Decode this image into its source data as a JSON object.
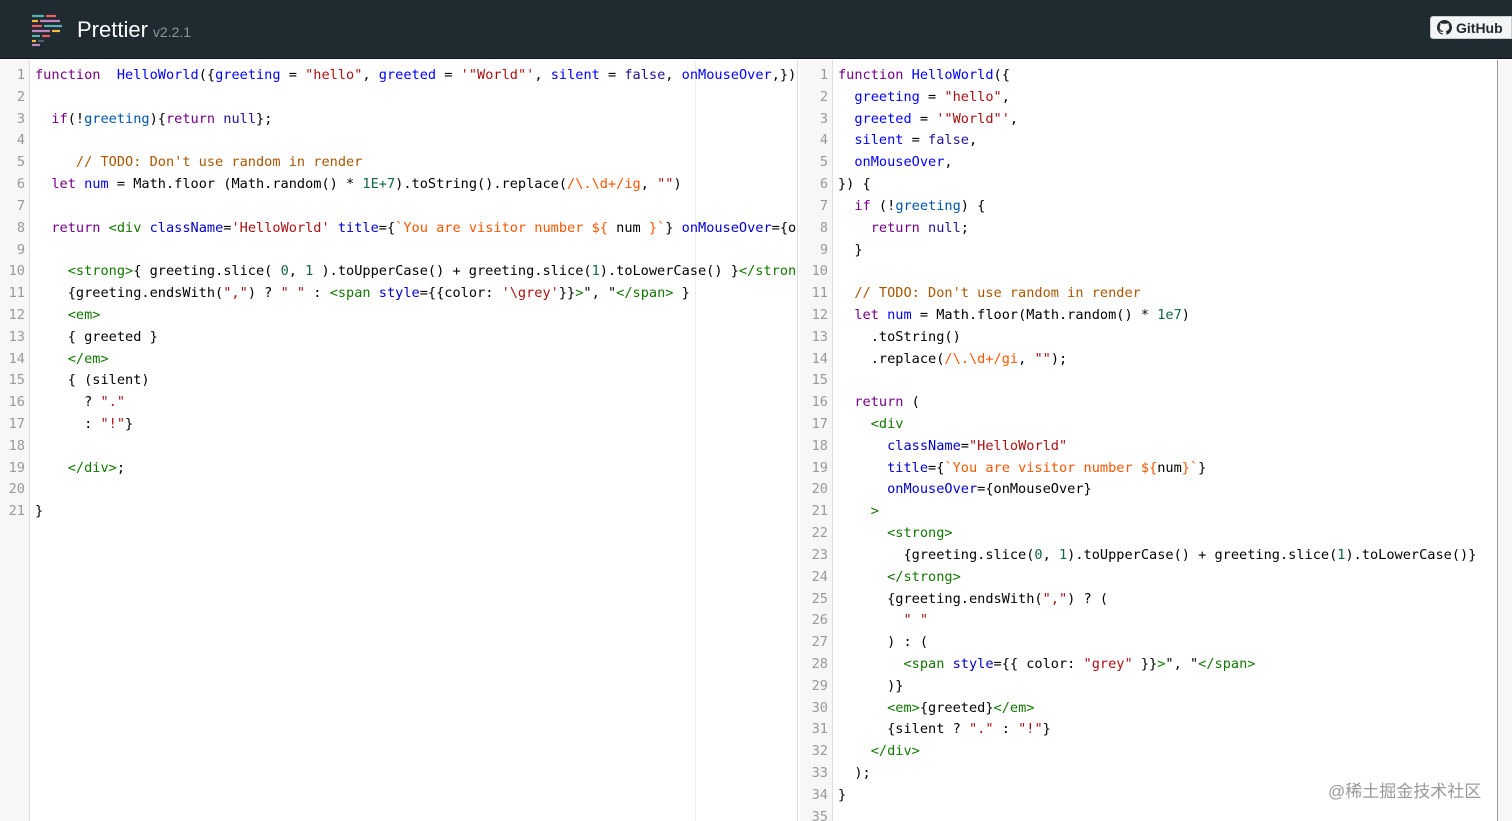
{
  "header": {
    "title": "Prettier",
    "version": "v2.2.1",
    "github_label": "GitHub"
  },
  "colors": {
    "header_bg": "#1f2a31",
    "keyword": "#770088",
    "def": "#0000ff",
    "string": "#aa1111",
    "comment": "#aa5500",
    "tag": "#117700"
  },
  "watermark": "@稀土掘金技术社区",
  "input_lines": [
    [
      [
        "kw",
        "function"
      ],
      [
        "",
        "  "
      ],
      [
        "def",
        "HelloWorld"
      ],
      [
        "",
        "({"
      ],
      [
        "def",
        "greeting"
      ],
      [
        "",
        " = "
      ],
      [
        "str",
        "\"hello\""
      ],
      [
        "",
        ", "
      ],
      [
        "def",
        "greeted"
      ],
      [
        "",
        " = "
      ],
      [
        "str",
        "'\"World\"'"
      ],
      [
        "",
        ", "
      ],
      [
        "def",
        "silent"
      ],
      [
        "",
        " = "
      ],
      [
        "atom",
        "false"
      ],
      [
        "",
        ", "
      ],
      [
        "def",
        "onMouseOver"
      ],
      [
        "",
        ",})"
      ]
    ],
    [],
    [
      [
        "",
        "  "
      ],
      [
        "kw",
        "if"
      ],
      [
        "",
        "(!"
      ],
      [
        "v2",
        "greeting"
      ],
      [
        "",
        "){"
      ],
      [
        "kw",
        "return"
      ],
      [
        "",
        " "
      ],
      [
        "atom",
        "null"
      ],
      [
        "",
        "};"
      ]
    ],
    [],
    [
      [
        "",
        "     "
      ],
      [
        "cm",
        "// TODO: Don't use random in render"
      ]
    ],
    [
      [
        "",
        "  "
      ],
      [
        "kw",
        "let"
      ],
      [
        "",
        " "
      ],
      [
        "def",
        "num"
      ],
      [
        "",
        " = Math.floor (Math.random() * "
      ],
      [
        "num",
        "1E+7"
      ],
      [
        "",
        ").toString().replace("
      ],
      [
        "s2",
        "/\\.\\d+/ig"
      ],
      [
        "",
        ", "
      ],
      [
        "str",
        "\"\""
      ],
      [
        "",
        ")"
      ]
    ],
    [],
    [
      [
        "",
        "  "
      ],
      [
        "kw",
        "return"
      ],
      [
        "",
        " "
      ],
      [
        "tag",
        "<div"
      ],
      [
        "",
        " "
      ],
      [
        "attr",
        "className"
      ],
      [
        "",
        "="
      ],
      [
        "str",
        "'HelloWorld'"
      ],
      [
        "",
        " "
      ],
      [
        "attr",
        "title"
      ],
      [
        "",
        "={"
      ],
      [
        "s2",
        "`You are visitor number ${"
      ],
      [
        "",
        " num "
      ],
      [
        "s2",
        "}`"
      ],
      [
        "",
        "} "
      ],
      [
        "attr",
        "onMouseOver"
      ],
      [
        "",
        "={onMouseOver}>"
      ]
    ],
    [],
    [
      [
        "",
        "    "
      ],
      [
        "tag",
        "<strong>"
      ],
      [
        "",
        "{ greeting.slice( "
      ],
      [
        "num",
        "0"
      ],
      [
        "",
        ", "
      ],
      [
        "num",
        "1"
      ],
      [
        "",
        " ).toUpperCase() + greeting.slice("
      ],
      [
        "num",
        "1"
      ],
      [
        "",
        ").toLowerCase() }"
      ],
      [
        "tag",
        "</strong>"
      ]
    ],
    [
      [
        "",
        "    {greeting.endsWith("
      ],
      [
        "str",
        "\",\""
      ],
      [
        "",
        ") ? "
      ],
      [
        "str",
        "\" \""
      ],
      [
        "",
        " : "
      ],
      [
        "tag",
        "<span"
      ],
      [
        "",
        " "
      ],
      [
        "attr",
        "style"
      ],
      [
        "",
        "={{color: "
      ],
      [
        "str",
        "'\\grey'"
      ],
      [
        "",
        "}}"
      ],
      [
        "tag",
        ">"
      ],
      [
        "",
        "\", \""
      ],
      [
        "tag",
        "</span>"
      ],
      [
        "",
        " }"
      ]
    ],
    [
      [
        "",
        "    "
      ],
      [
        "tag",
        "<em>"
      ]
    ],
    [
      [
        "",
        "    { greeted }"
      ]
    ],
    [
      [
        "",
        "    "
      ],
      [
        "tag",
        "</em>"
      ]
    ],
    [
      [
        "",
        "    { (silent)"
      ]
    ],
    [
      [
        "",
        "      ? "
      ],
      [
        "str",
        "\".\""
      ]
    ],
    [
      [
        "",
        "      : "
      ],
      [
        "str",
        "\"!\""
      ],
      [
        "",
        "}"
      ]
    ],
    [],
    [
      [
        "",
        "    "
      ],
      [
        "tag",
        "</div>"
      ],
      [
        "",
        ";"
      ]
    ],
    [],
    [
      [
        "",
        "}"
      ]
    ]
  ],
  "output_lines": [
    [
      [
        "kw",
        "function"
      ],
      [
        "",
        " "
      ],
      [
        "def",
        "HelloWorld"
      ],
      [
        "",
        "({"
      ]
    ],
    [
      [
        "",
        "  "
      ],
      [
        "def",
        "greeting"
      ],
      [
        "",
        " = "
      ],
      [
        "str",
        "\"hello\""
      ],
      [
        "",
        ","
      ]
    ],
    [
      [
        "",
        "  "
      ],
      [
        "def",
        "greeted"
      ],
      [
        "",
        " = "
      ],
      [
        "str",
        "'\"World\"'"
      ],
      [
        "",
        ","
      ]
    ],
    [
      [
        "",
        "  "
      ],
      [
        "def",
        "silent"
      ],
      [
        "",
        " = "
      ],
      [
        "atom",
        "false"
      ],
      [
        "",
        ","
      ]
    ],
    [
      [
        "",
        "  "
      ],
      [
        "def",
        "onMouseOver"
      ],
      [
        "",
        ","
      ]
    ],
    [
      [
        "",
        "}) {"
      ]
    ],
    [
      [
        "",
        "  "
      ],
      [
        "kw",
        "if"
      ],
      [
        "",
        " (!"
      ],
      [
        "v2",
        "greeting"
      ],
      [
        "",
        ") {"
      ]
    ],
    [
      [
        "",
        "    "
      ],
      [
        "kw",
        "return"
      ],
      [
        "",
        " "
      ],
      [
        "atom",
        "null"
      ],
      [
        "",
        ";"
      ]
    ],
    [
      [
        "",
        "  }"
      ]
    ],
    [],
    [
      [
        "",
        "  "
      ],
      [
        "cm",
        "// TODO: Don't use random in render"
      ]
    ],
    [
      [
        "",
        "  "
      ],
      [
        "kw",
        "let"
      ],
      [
        "",
        " "
      ],
      [
        "def",
        "num"
      ],
      [
        "",
        " = Math.floor(Math.random() * "
      ],
      [
        "num",
        "1e7"
      ],
      [
        "",
        ")"
      ]
    ],
    [
      [
        "",
        "    .toString()"
      ]
    ],
    [
      [
        "",
        "    .replace("
      ],
      [
        "s2",
        "/\\.\\d+/gi"
      ],
      [
        "",
        ", "
      ],
      [
        "str",
        "\"\""
      ],
      [
        "",
        ");"
      ]
    ],
    [],
    [
      [
        "",
        "  "
      ],
      [
        "kw",
        "return"
      ],
      [
        "",
        " ("
      ]
    ],
    [
      [
        "",
        "    "
      ],
      [
        "tag",
        "<div"
      ]
    ],
    [
      [
        "",
        "      "
      ],
      [
        "attr",
        "className"
      ],
      [
        "",
        "="
      ],
      [
        "str",
        "\"HelloWorld\""
      ]
    ],
    [
      [
        "",
        "      "
      ],
      [
        "attr",
        "title"
      ],
      [
        "",
        "={"
      ],
      [
        "s2",
        "`You are visitor number ${"
      ],
      [
        "",
        "num"
      ],
      [
        "s2",
        "}`"
      ],
      [
        "",
        "}"
      ]
    ],
    [
      [
        "",
        "      "
      ],
      [
        "attr",
        "onMouseOver"
      ],
      [
        "",
        "={onMouseOver}"
      ]
    ],
    [
      [
        "",
        "    "
      ],
      [
        "tag",
        ">"
      ]
    ],
    [
      [
        "",
        "      "
      ],
      [
        "tag",
        "<strong>"
      ]
    ],
    [
      [
        "",
        "        {greeting.slice("
      ],
      [
        "num",
        "0"
      ],
      [
        "",
        ", "
      ],
      [
        "num",
        "1"
      ],
      [
        "",
        ").toUpperCase() + greeting.slice("
      ],
      [
        "num",
        "1"
      ],
      [
        "",
        ").toLowerCase()}"
      ]
    ],
    [
      [
        "",
        "      "
      ],
      [
        "tag",
        "</strong>"
      ]
    ],
    [
      [
        "",
        "      {greeting.endsWith("
      ],
      [
        "str",
        "\",\""
      ],
      [
        "",
        ") ? ("
      ]
    ],
    [
      [
        "",
        "        "
      ],
      [
        "str",
        "\" \""
      ]
    ],
    [
      [
        "",
        "      ) : ("
      ]
    ],
    [
      [
        "",
        "        "
      ],
      [
        "tag",
        "<span"
      ],
      [
        "",
        " "
      ],
      [
        "attr",
        "style"
      ],
      [
        "",
        "={{ color: "
      ],
      [
        "str",
        "\"grey\""
      ],
      [
        "",
        " }}"
      ],
      [
        "tag",
        ">"
      ],
      [
        "",
        "\", \""
      ],
      [
        "tag",
        "</span>"
      ]
    ],
    [
      [
        "",
        "      )}"
      ]
    ],
    [
      [
        "",
        "      "
      ],
      [
        "tag",
        "<em>"
      ],
      [
        "",
        "{greeted}"
      ],
      [
        "tag",
        "</em>"
      ]
    ],
    [
      [
        "",
        "      {silent ? "
      ],
      [
        "str",
        "\".\""
      ],
      [
        "",
        " : "
      ],
      [
        "str",
        "\"!\""
      ],
      [
        "",
        "}"
      ]
    ],
    [
      [
        "",
        "    "
      ],
      [
        "tag",
        "</div>"
      ]
    ],
    [
      [
        "",
        "  );"
      ]
    ],
    [
      [
        "",
        "}"
      ]
    ],
    []
  ]
}
